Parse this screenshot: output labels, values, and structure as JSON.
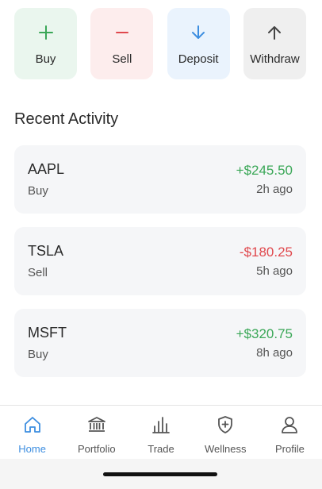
{
  "actions": [
    {
      "label": "Buy",
      "icon": "plus-icon",
      "color": "#3aa757"
    },
    {
      "label": "Sell",
      "icon": "minus-icon",
      "color": "#e0484d"
    },
    {
      "label": "Deposit",
      "icon": "arrow-down-icon",
      "color": "#3d8ee0"
    },
    {
      "label": "Withdraw",
      "icon": "arrow-up-icon",
      "color": "#444444"
    }
  ],
  "recent": {
    "title": "Recent Activity",
    "items": [
      {
        "symbol": "AAPL",
        "type": "Buy",
        "amount": "+$245.50",
        "time": "2h ago",
        "amount_color": "#3aa757"
      },
      {
        "symbol": "TSLA",
        "type": "Sell",
        "amount": "-$180.25",
        "time": "5h ago",
        "amount_color": "#e0484d"
      },
      {
        "symbol": "MSFT",
        "type": "Buy",
        "amount": "+$320.75",
        "time": "8h ago",
        "amount_color": "#3aa757"
      }
    ]
  },
  "tabs": [
    {
      "label": "Home",
      "icon": "home-icon",
      "active": true
    },
    {
      "label": "Portfolio",
      "icon": "bank-icon",
      "active": false
    },
    {
      "label": "Trade",
      "icon": "bar-chart-icon",
      "active": false
    },
    {
      "label": "Wellness",
      "icon": "shield-plus-icon",
      "active": false
    },
    {
      "label": "Profile",
      "icon": "user-icon",
      "active": false
    }
  ],
  "colors": {
    "accent": "#3d8ee0",
    "positive": "#3aa757",
    "negative": "#e0484d"
  }
}
